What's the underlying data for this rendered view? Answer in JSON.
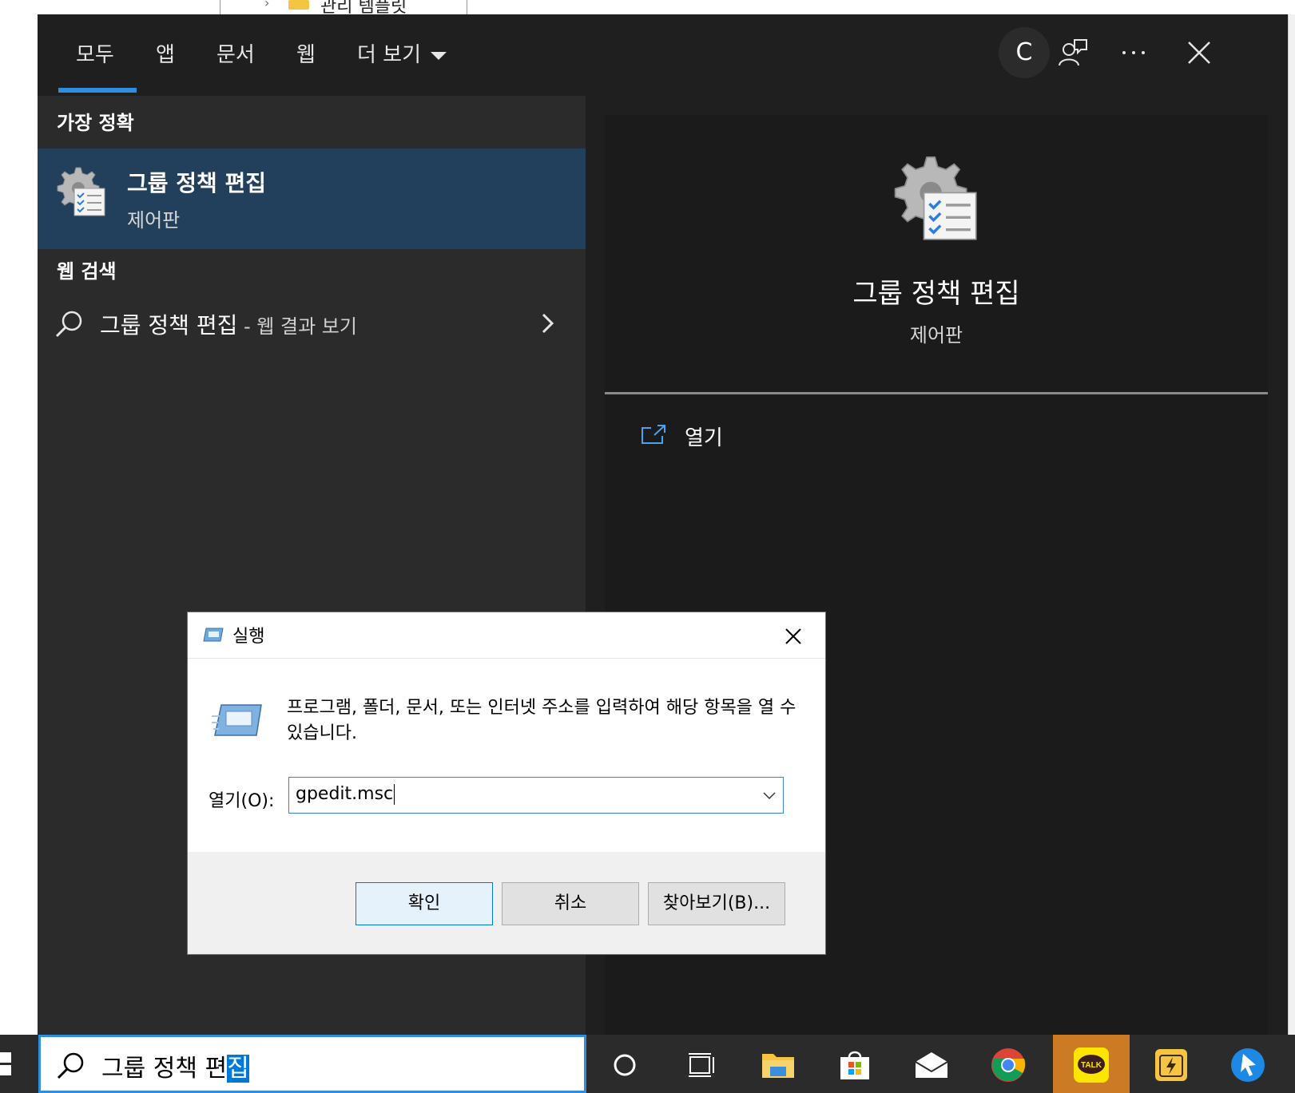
{
  "background": {
    "breadcrumb_text": "관리 템플릿"
  },
  "tabs": [
    {
      "label": "모두",
      "active": true
    },
    {
      "label": "앱"
    },
    {
      "label": "문서"
    },
    {
      "label": "웹"
    },
    {
      "label": "더 보기"
    }
  ],
  "header": {
    "avatar_initial": "C",
    "accent_color": "#2f8ee0"
  },
  "best_match": {
    "section_title": "가장 정확",
    "title": "그룹 정책 편집",
    "subtitle": "제어판"
  },
  "web_search": {
    "section_title": "웹 검색",
    "query": "그룹 정책 편집",
    "separator": " - ",
    "suffix": "웹 결과 보기"
  },
  "preview": {
    "title": "그룹 정책 편집",
    "subtitle": "제어판",
    "actions": [
      {
        "label": "열기",
        "icon": "open-icon"
      }
    ]
  },
  "run_dialog": {
    "title": "실행",
    "description": "프로그램, 폴더, 문서, 또는 인터넷 주소를 입력하여 해당 항목을 열 수 있습니다.",
    "open_label": "열기(O):",
    "input_value": "gpedit.msc",
    "buttons": {
      "ok": "확인",
      "cancel": "취소",
      "browse": "찾아보기(B)..."
    }
  },
  "taskbar": {
    "search_text_unselected": "그룹 정책 편",
    "search_text_selected": "집",
    "apps": [
      {
        "name": "cortana",
        "icon": "circle-icon"
      },
      {
        "name": "task-view",
        "icon": "task-view-icon"
      },
      {
        "name": "file-explorer",
        "icon": "folder-icon"
      },
      {
        "name": "microsoft-store",
        "icon": "store-icon"
      },
      {
        "name": "mail",
        "icon": "mail-icon"
      },
      {
        "name": "chrome",
        "icon": "chrome-icon"
      },
      {
        "name": "kakaotalk",
        "icon": "kakaotalk-icon",
        "label": "TALK"
      },
      {
        "name": "power-automate",
        "icon": "lightning-icon"
      },
      {
        "name": "quick-assist",
        "icon": "arrow-icon"
      }
    ]
  }
}
